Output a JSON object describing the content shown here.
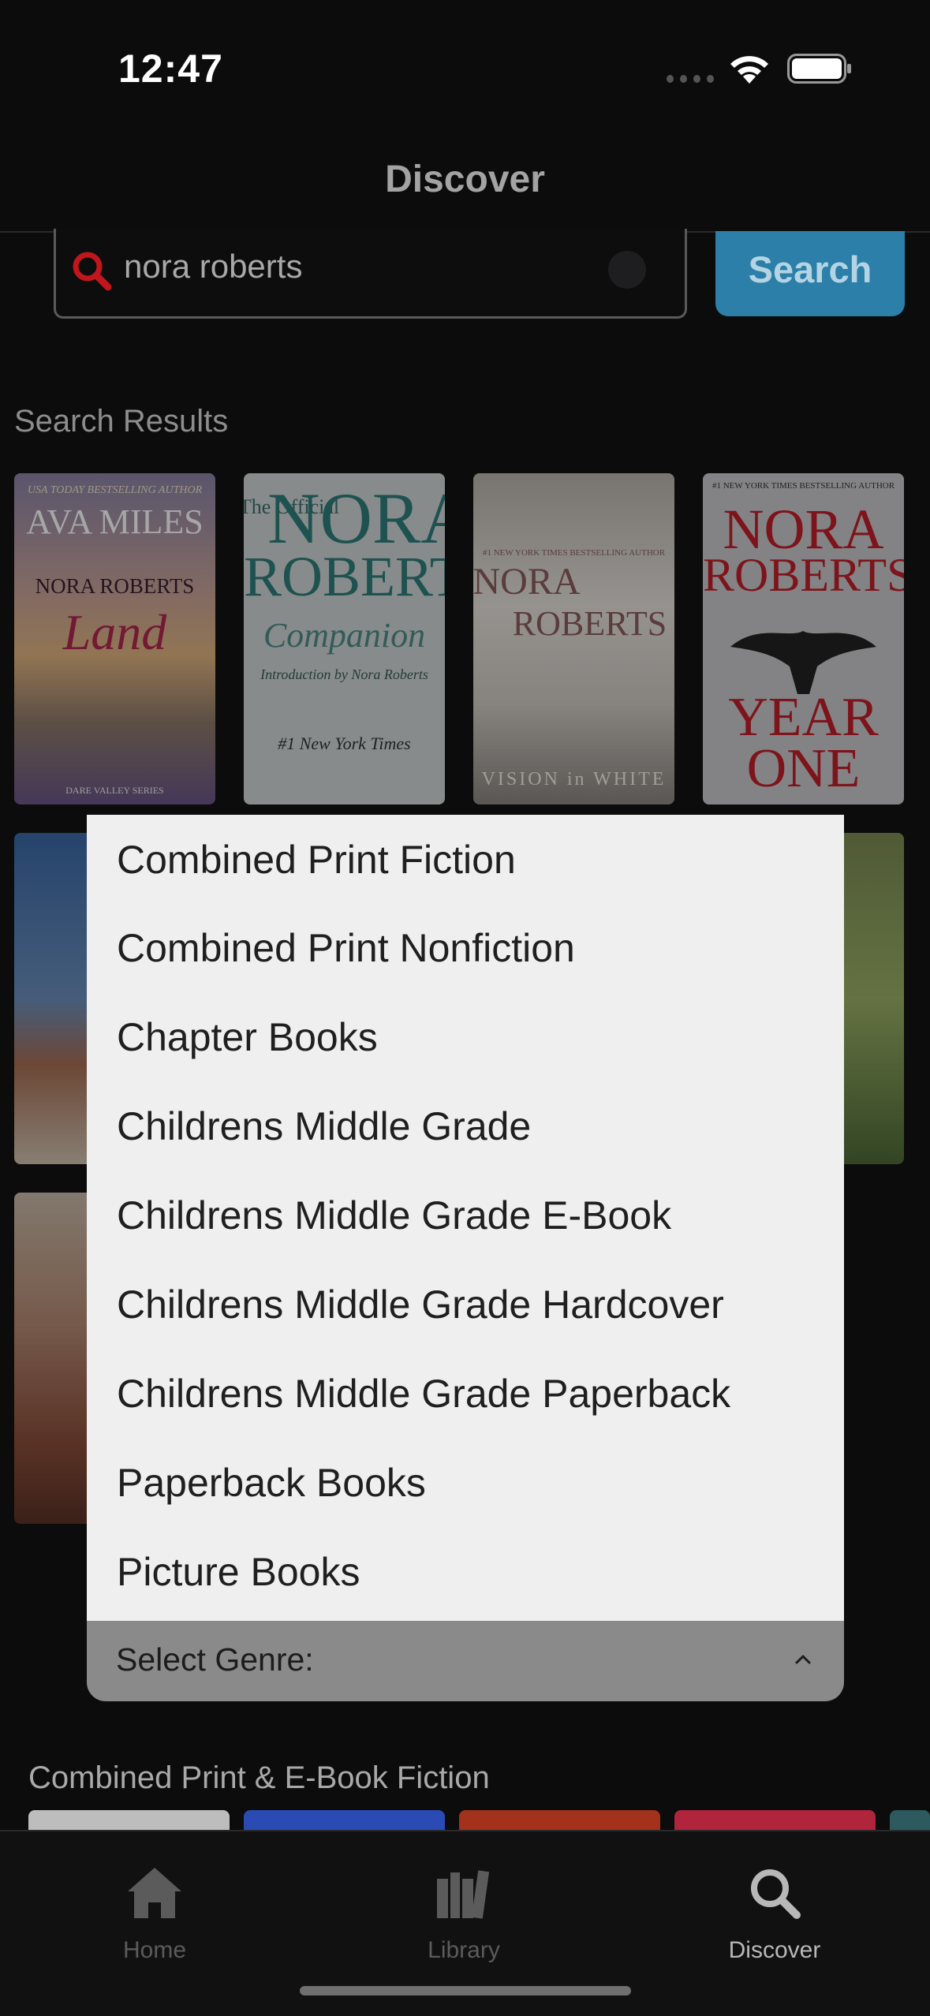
{
  "status_bar": {
    "time": "12:47"
  },
  "header": {
    "title": "Discover"
  },
  "search": {
    "value": "nora roberts",
    "button_label": "Search"
  },
  "sections": {
    "results_title": "Search Results",
    "list_title": "Combined Print & E-Book Fiction"
  },
  "books": [
    {
      "lines": [
        "USA TODAY BESTSELLING AUTHOR",
        "AVA MILES",
        "NORA ROBERTS",
        "Land",
        "DARE VALLEY SERIES"
      ]
    },
    {
      "lines": [
        "The Official",
        "NORA",
        "ROBERTS",
        "Companion",
        "Introduction by Nora Roberts",
        "#1 New York Times"
      ]
    },
    {
      "lines": [
        "#1 NEW YORK TIMES BESTSELLING AUTHOR",
        "NORA",
        "ROBERTS",
        "VISION in WHITE"
      ]
    },
    {
      "lines": [
        "#1 NEW YORK TIMES BESTSELLING AUTHOR",
        "NORA",
        "ROBERTS",
        "YEAR",
        "ONE"
      ]
    }
  ],
  "dropdown": {
    "items": [
      "Combined Print Fiction",
      "Combined Print Nonfiction",
      "Chapter Books",
      "Childrens Middle Grade",
      "Childrens Middle Grade E-Book",
      "Childrens Middle Grade Hardcover",
      "Childrens Middle Grade Paperback",
      "Paperback Books",
      "Picture Books"
    ],
    "select_label": "Select Genre:"
  },
  "tabs": [
    {
      "label": "Home",
      "icon": "home-icon",
      "active": false
    },
    {
      "label": "Library",
      "icon": "library-icon",
      "active": false
    },
    {
      "label": "Discover",
      "icon": "search-icon",
      "active": true
    }
  ],
  "colors": {
    "accent": "#2b7fa8",
    "search_icon": "#c0161c",
    "background": "#0c0c0d",
    "dropdown_bg": "#efefef"
  }
}
